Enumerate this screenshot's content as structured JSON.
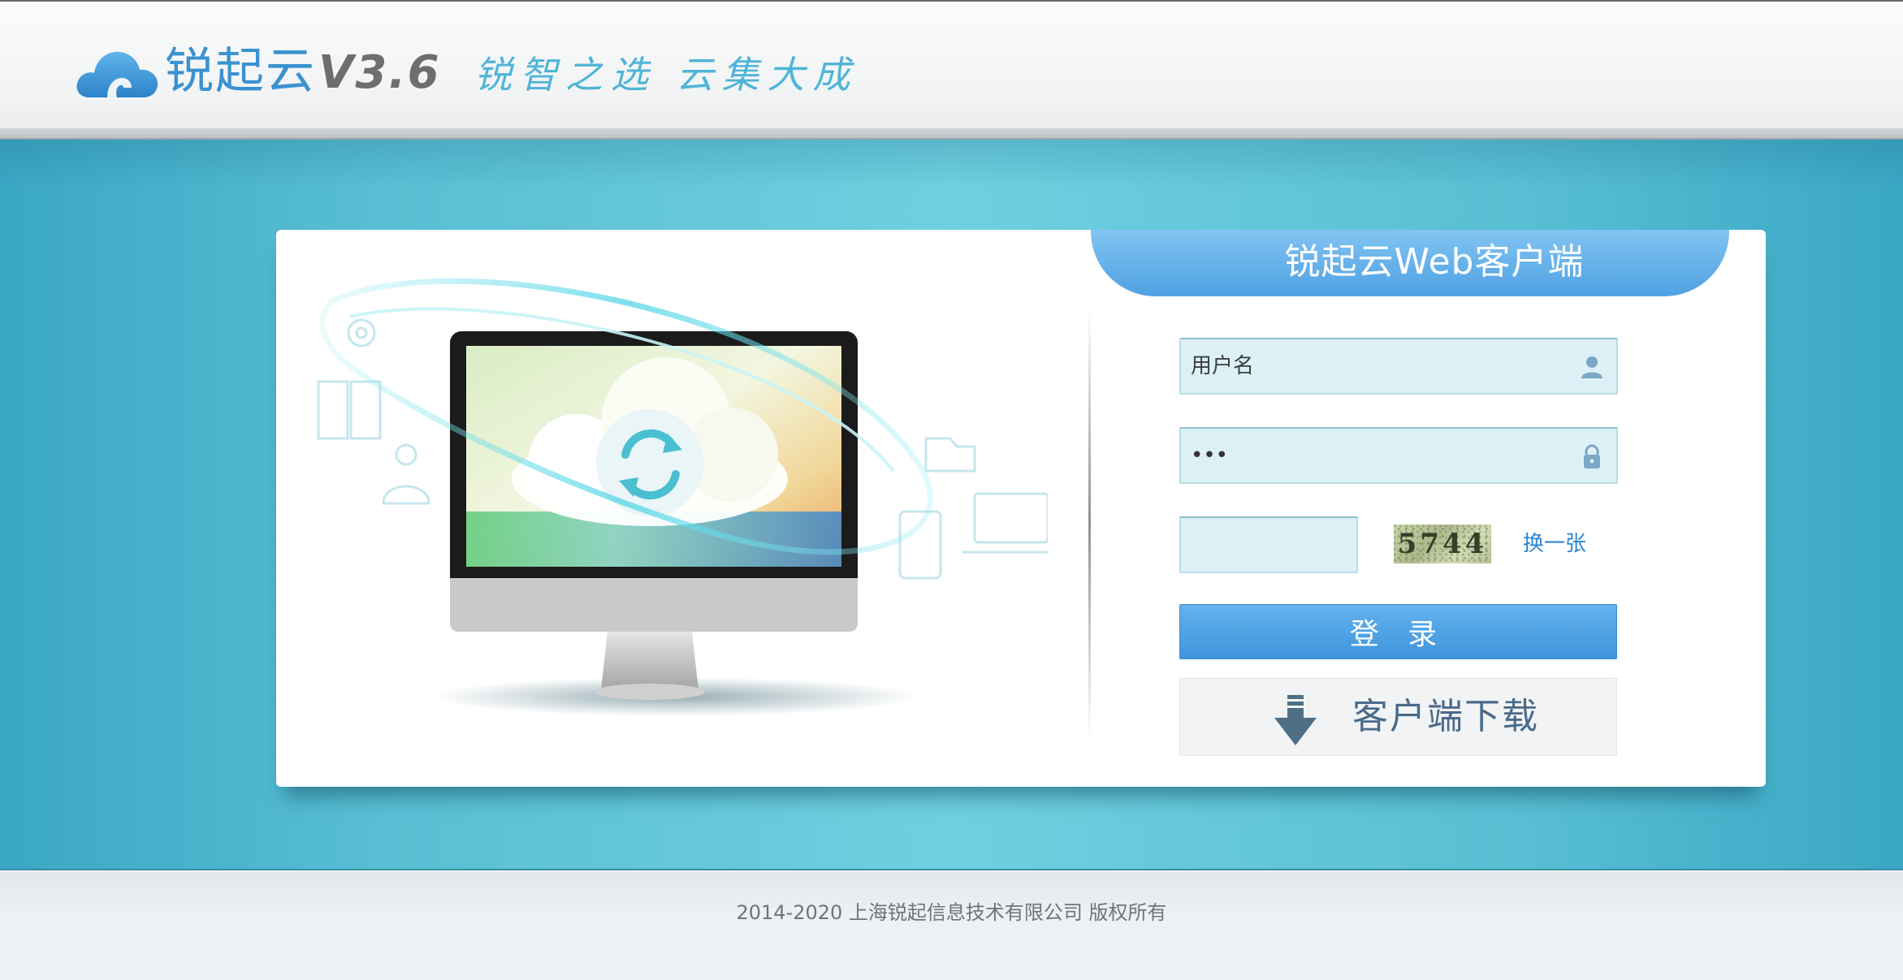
{
  "header": {
    "logo_name": "锐起云",
    "version": "V3.6",
    "slogan": "锐智之选  云集大成",
    "logo_icon": "cloud-icon"
  },
  "login": {
    "title": "锐起云Web客户端",
    "username": {
      "placeholder": "用户名",
      "value": "",
      "icon": "user-icon"
    },
    "password": {
      "value": "•••",
      "icon": "lock-icon"
    },
    "captcha": {
      "value": "",
      "image_text": "5744",
      "refresh_label": "换一张"
    },
    "submit_label": "登 录",
    "download": {
      "label": "客户端下载",
      "icon": "download-arrow-icon"
    }
  },
  "illustration": {
    "screen_icon": "sync-refresh-icon"
  },
  "footer": {
    "copyright": "2014-2020 上海锐起信息技术有限公司 版权所有"
  },
  "colors": {
    "brand_blue": "#3a92d0",
    "band_teal": "#58bfd4",
    "button_blue": "#4fa1e3",
    "link_blue": "#2a86d1"
  }
}
